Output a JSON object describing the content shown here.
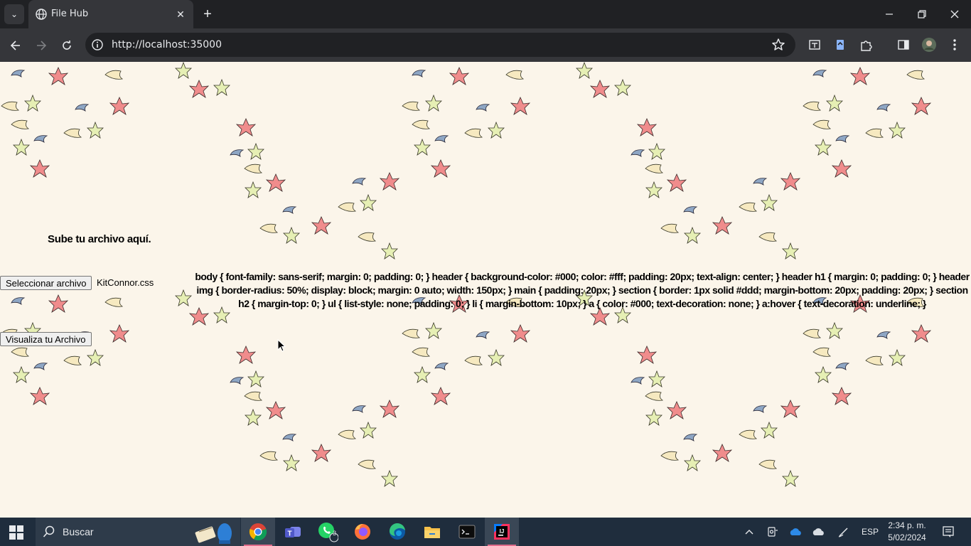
{
  "browser": {
    "tab_title": "File Hub",
    "url": "http://localhost:35000"
  },
  "page": {
    "upload_heading": "Sube tu archivo aquí.",
    "select_file_button": "Seleccionar archivo",
    "selected_file_name": "KitConnor.css",
    "view_file_button": "Visualiza tu Archivo",
    "file_content": "body { font-family: sans-serif; margin: 0; padding: 0; } header { background-color: #000; color: #fff; padding: 20px; text-align: center; } header h1 { margin: 0; padding: 0; } header img { border-radius: 50%; display: block; margin: 0 auto; width: 150px; } main { padding: 20px; } section { border: 1px solid #ddd; margin-bottom: 20px; padding: 20px; } section h2 { margin-top: 0; } ul { list-style: none; padding: 0; } li { margin-bottom: 10px; } a { color: #000; text-decoration: none; } a:hover { text-decoration: underline; }"
  },
  "taskbar": {
    "search_placeholder": "Buscar",
    "whatsapp_badge": "3",
    "language": "ESP",
    "time": "2:34 p. m.",
    "date": "5/02/2024"
  },
  "colors": {
    "page_background": "#fbf5ea",
    "taskbar": "#1f2d3d",
    "chrome_dark": "#202124",
    "chrome_toolbar": "#35363a",
    "leaf_red": "#f08c8c",
    "leaf_green": "#e6efb4",
    "leaf_yellow": "#f6e9c0",
    "leaf_blue": "#8ea6c4"
  }
}
